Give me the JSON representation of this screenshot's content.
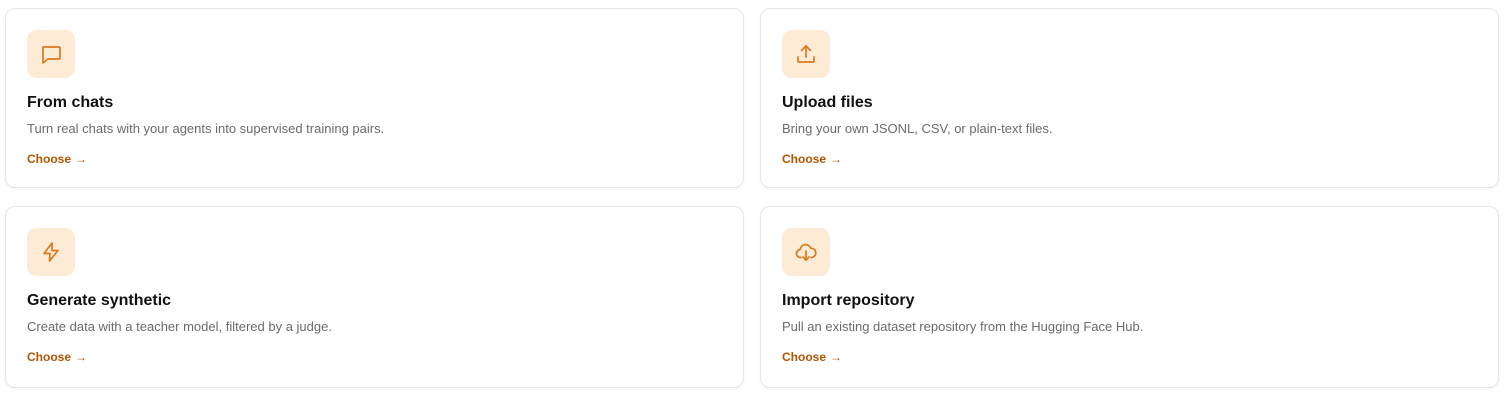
{
  "accent_color": "#d97a1a",
  "icon_bg_color": "#fdebd5",
  "cards": [
    {
      "icon": "chat-bubble-icon",
      "title": "From chats",
      "description": "Turn real chats with your agents into supervised training pairs.",
      "action_label": "Choose",
      "action_arrow": "→"
    },
    {
      "icon": "upload-icon",
      "title": "Upload files",
      "description": "Bring your own JSONL, CSV, or plain-text files.",
      "action_label": "Choose",
      "action_arrow": "→"
    },
    {
      "icon": "lightning-icon",
      "title": "Generate synthetic",
      "description": "Create data with a teacher model, filtered by a judge.",
      "action_label": "Choose",
      "action_arrow": "→"
    },
    {
      "icon": "cloud-download-icon",
      "title": "Import repository",
      "description": "Pull an existing dataset repository from the Hugging Face Hub.",
      "action_label": "Choose",
      "action_arrow": "→"
    }
  ]
}
